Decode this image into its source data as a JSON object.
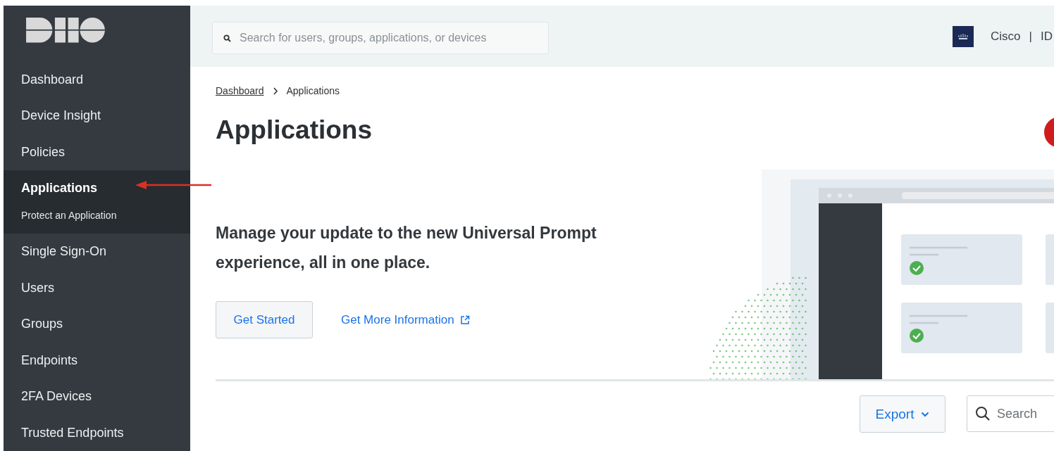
{
  "sidebar": {
    "items": [
      {
        "label": "Dashboard",
        "selected": false
      },
      {
        "label": "Device Insight",
        "selected": false
      },
      {
        "label": "Policies",
        "selected": false
      },
      {
        "label": "Applications",
        "selected": true,
        "children": [
          {
            "label": "Protect an Application",
            "selected": false
          }
        ]
      },
      {
        "label": "Single Sign-On",
        "selected": false
      },
      {
        "label": "Users",
        "selected": false
      },
      {
        "label": "Groups",
        "selected": false
      },
      {
        "label": "Endpoints",
        "selected": false
      },
      {
        "label": "2FA Devices",
        "selected": false
      },
      {
        "label": "Trusted Endpoints",
        "selected": false
      }
    ]
  },
  "header": {
    "search": {
      "placeholder": "Search for users, groups, applications, or devices"
    },
    "account": "Cisco",
    "separator": "|",
    "account_suffix": "ID"
  },
  "breadcrumb": [
    {
      "label": "Dashboard",
      "kind": "link"
    },
    {
      "label": "Applications",
      "kind": "current"
    }
  ],
  "title": "Applications",
  "banner": {
    "heading": "Manage your update to the new Universal Prompt experience, all in one place.",
    "primary_button": "Get Started",
    "link": "Get More Information"
  },
  "toolbar": {
    "export_button": "Export",
    "search": {
      "placeholder": "Search"
    }
  }
}
